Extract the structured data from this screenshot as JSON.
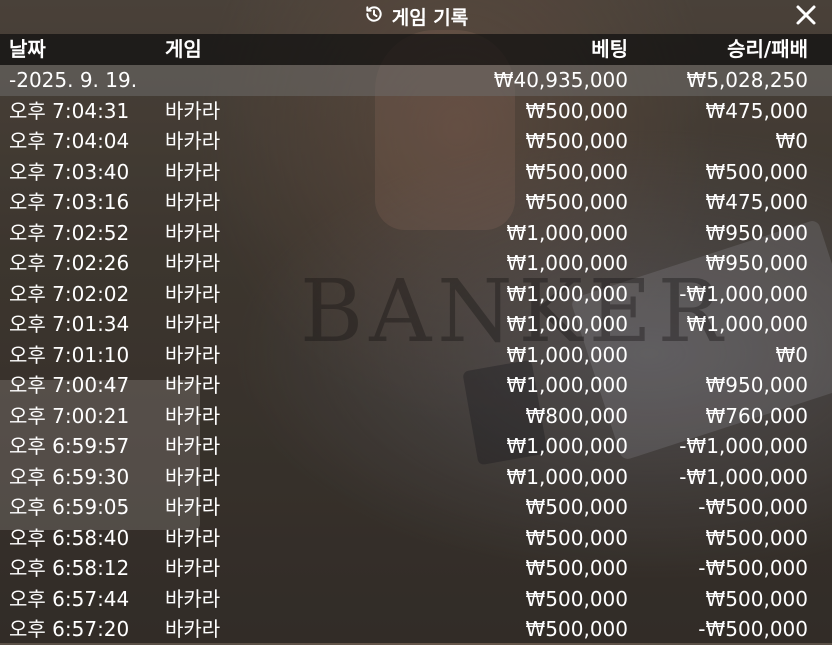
{
  "header": {
    "title": "게임 기록",
    "history_icon": "history-icon",
    "close_icon": "close-icon"
  },
  "columns": {
    "date": "날짜",
    "game": "게임",
    "bet": "베팅",
    "result": "승리/패배"
  },
  "summary": {
    "date": "-2025. 9. 19.",
    "bet": "₩40,935,000",
    "result": "₩5,028,250"
  },
  "rows": [
    {
      "time": "오후 7:04:31",
      "game": "바카라",
      "bet": "₩500,000",
      "result": "₩475,000"
    },
    {
      "time": "오후 7:04:04",
      "game": "바카라",
      "bet": "₩500,000",
      "result": "₩0"
    },
    {
      "time": "오후 7:03:40",
      "game": "바카라",
      "bet": "₩500,000",
      "result": "₩500,000"
    },
    {
      "time": "오후 7:03:16",
      "game": "바카라",
      "bet": "₩500,000",
      "result": "₩475,000"
    },
    {
      "time": "오후 7:02:52",
      "game": "바카라",
      "bet": "₩1,000,000",
      "result": "₩950,000"
    },
    {
      "time": "오후 7:02:26",
      "game": "바카라",
      "bet": "₩1,000,000",
      "result": "₩950,000"
    },
    {
      "time": "오후 7:02:02",
      "game": "바카라",
      "bet": "₩1,000,000",
      "result": "-₩1,000,000"
    },
    {
      "time": "오후 7:01:34",
      "game": "바카라",
      "bet": "₩1,000,000",
      "result": "₩1,000,000"
    },
    {
      "time": "오후 7:01:10",
      "game": "바카라",
      "bet": "₩1,000,000",
      "result": "₩0"
    },
    {
      "time": "오후 7:00:47",
      "game": "바카라",
      "bet": "₩1,000,000",
      "result": "₩950,000"
    },
    {
      "time": "오후 7:00:21",
      "game": "바카라",
      "bet": "₩800,000",
      "result": "₩760,000"
    },
    {
      "time": "오후 6:59:57",
      "game": "바카라",
      "bet": "₩1,000,000",
      "result": "-₩1,000,000"
    },
    {
      "time": "오후 6:59:30",
      "game": "바카라",
      "bet": "₩1,000,000",
      "result": "-₩1,000,000"
    },
    {
      "time": "오후 6:59:05",
      "game": "바카라",
      "bet": "₩500,000",
      "result": "-₩500,000"
    },
    {
      "time": "오후 6:58:40",
      "game": "바카라",
      "bet": "₩500,000",
      "result": "₩500,000"
    },
    {
      "time": "오후 6:58:12",
      "game": "바카라",
      "bet": "₩500,000",
      "result": "-₩500,000"
    },
    {
      "time": "오후 6:57:44",
      "game": "바카라",
      "bet": "₩500,000",
      "result": "₩500,000"
    },
    {
      "time": "오후 6:57:20",
      "game": "바카라",
      "bet": "₩500,000",
      "result": "-₩500,000"
    }
  ],
  "background_text": "BANKER",
  "colors": {
    "text": "#ffffff",
    "header_bg": "#0f0f0f",
    "summary_bg": "#6e6c6a"
  }
}
